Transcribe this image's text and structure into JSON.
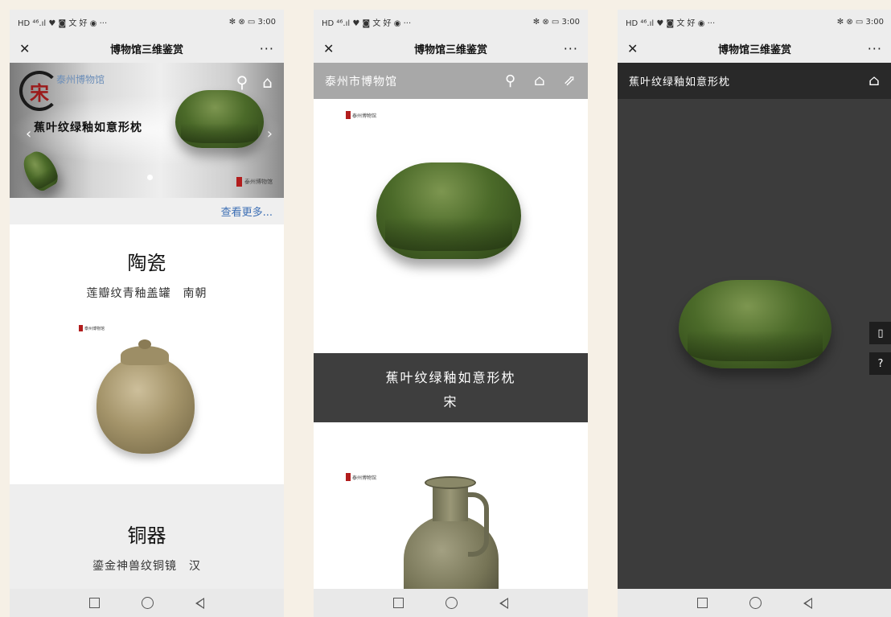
{
  "status_bar": {
    "left": "HD ⁴⁶.ıl ♥ ◙ 文 好 ◉ ···",
    "right": "✻ ⊗ ▭ 3:00"
  },
  "window_title": "博物馆三维鉴赏",
  "nav_bar": {
    "back_icon": "triangle-back-icon",
    "home_icon": "circle-home-icon",
    "recent_icon": "square-recent-icon"
  },
  "screen1": {
    "banner_seal": "宋",
    "banner_site": "泰州博物馆",
    "banner_caption": "蕉叶纹绿釉如意形枕",
    "banner_brand": "泰州博物馆",
    "more_link": "查看更多...",
    "ceramics": {
      "title": "陶瓷",
      "subtitle": "莲瓣纹青釉盖罐　南朝",
      "brand": "泰州博物馆"
    },
    "bronze": {
      "title": "铜器",
      "subtitle": "鎏金神兽纹铜镜　汉"
    }
  },
  "screen2": {
    "site_title": "泰州市博物馆",
    "brand": "泰州博物馆",
    "item_name": "蕉叶纹绿釉如意形枕",
    "item_dynasty": "宋",
    "brand2": "泰州博物馆"
  },
  "screen3": {
    "item_name": "蕉叶纹绿釉如意形枕",
    "side_buttons": [
      "book-icon",
      "help-icon"
    ]
  }
}
